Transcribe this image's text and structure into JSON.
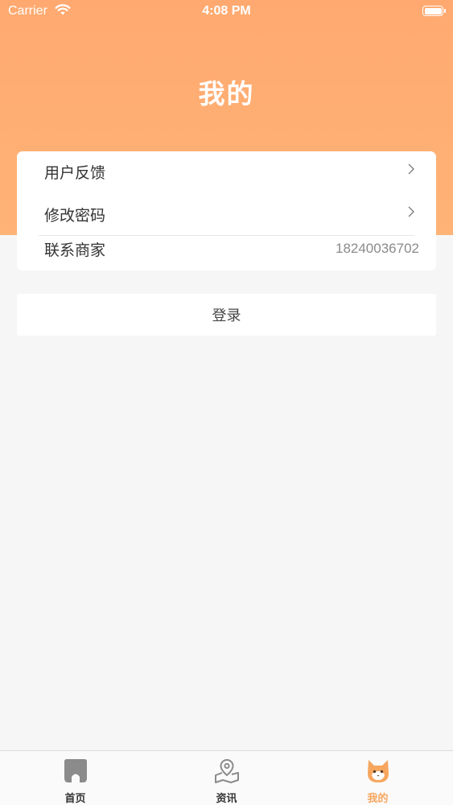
{
  "status_bar": {
    "carrier": "Carrier",
    "time": "4:08 PM",
    "icons": [
      "wifi-icon",
      "battery-icon"
    ]
  },
  "header": {
    "title": "我的",
    "accent_color": "#ffa970"
  },
  "menu": {
    "items": [
      {
        "label": "用户反馈",
        "icon": "chevron-right-icon"
      },
      {
        "label": "修改密码",
        "icon": "chevron-right-icon"
      },
      {
        "label": "联系商家",
        "value": "18240036702"
      }
    ]
  },
  "login": {
    "label": "登录"
  },
  "tab_bar": {
    "active_color": "#f7a65e",
    "tabs": [
      {
        "label": "首页",
        "icon": "home-icon",
        "active": false
      },
      {
        "label": "资讯",
        "icon": "map-pin-icon",
        "active": false
      },
      {
        "label": "我的",
        "icon": "fox-profile-icon",
        "active": true
      }
    ]
  }
}
